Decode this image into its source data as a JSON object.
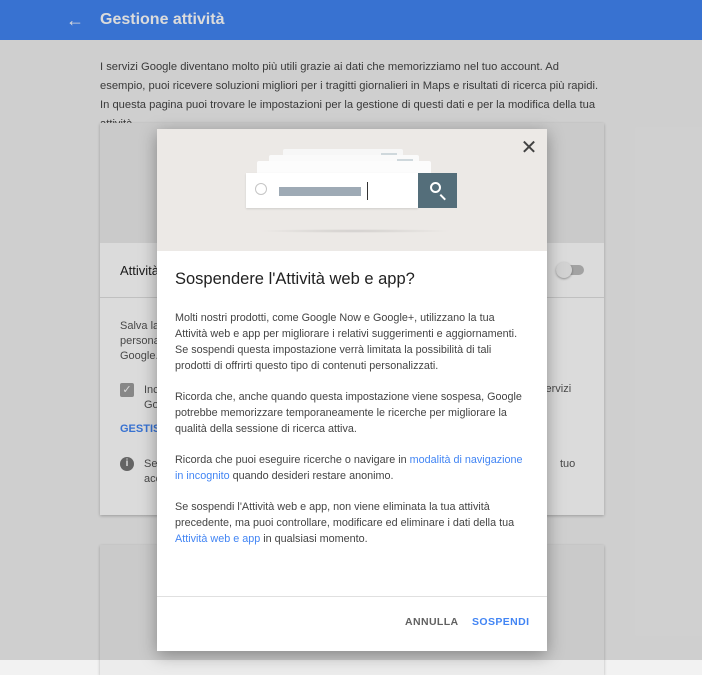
{
  "header": {
    "title": "Gestione attività",
    "back_icon": "arrow-left-icon",
    "color": "#4285f4"
  },
  "intro": "I servizi Google diventano molto più utili grazie ai dati che memorizziamo nel tuo account. Ad esempio, puoi ricevere soluzioni migliori per i tragitti giornalieri in Maps e risultati di ricerca più rapidi. In questa pagina puoi trovare le impostazioni per la gestione di questi dati e per la modifica della tua attività.",
  "background_card": {
    "row_title": "Attività",
    "text_salva": "Salva la",
    "text_persona": "persona",
    "text_google": "Google.",
    "text_inc": "Inc",
    "text_go": "Go",
    "text_servizi": "servizi",
    "link_gestisci": "GESTISCI",
    "text_se": "Se",
    "text_acc": "acc",
    "text_tuo": "tuo"
  },
  "dialog": {
    "title": "Sospendere l'Attività web e app?",
    "p1": "Molti nostri prodotti, come Google Now e Google+, utilizzano la tua Attività web e app per migliorare i relativi suggerimenti e aggiornamenti. Se sospendi questa impostazione verrà limitata la possibilità di tali prodotti di offrirti questo tipo di contenuti personalizzati.",
    "p2": "Ricorda che, anche quando questa impostazione viene sospesa, Google potrebbe memorizzare temporaneamente le ricerche per migliorare la qualità della sessione di ricerca attiva.",
    "p3_pre": "Ricorda che puoi eseguire ricerche o navigare in ",
    "p3_link": "modalità di navigazione in incognito",
    "p3_post": " quando desideri restare anonimo.",
    "p4_pre": "Se sospendi l'Attività web e app, non viene eliminata la tua attività precedente, ma puoi controllare, modificare ed eliminare i dati della tua ",
    "p4_link": "Attività web e app",
    "p4_post": " in qualsiasi momento.",
    "cancel_label": "ANNULLA",
    "confirm_label": "SOSPENDI",
    "close_icon": "close-icon",
    "search_icon": "search-icon",
    "clock_icon": "clock-icon"
  }
}
